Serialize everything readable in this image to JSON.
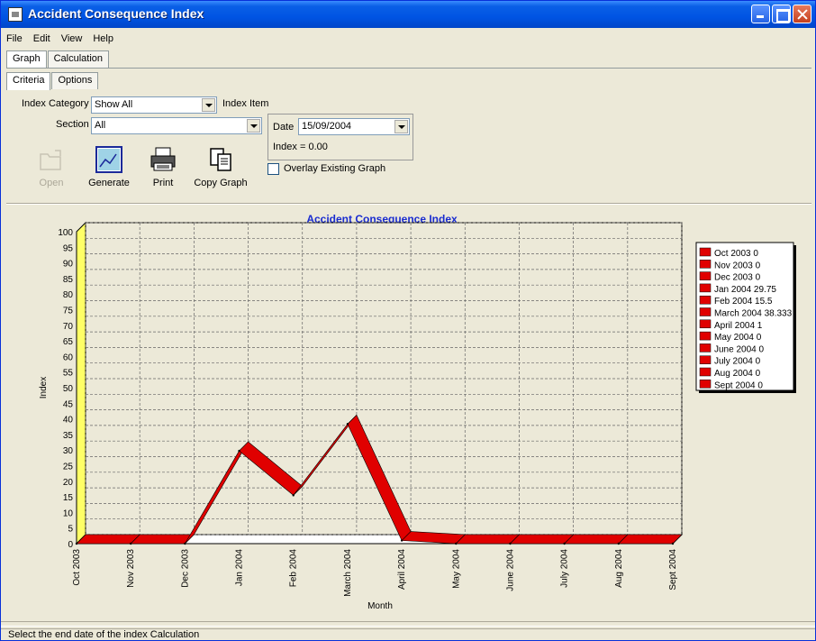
{
  "window": {
    "title": "Accident Consequence Index"
  },
  "menu": {
    "items": [
      "File",
      "Edit",
      "View",
      "Help"
    ]
  },
  "tabs_main": [
    {
      "label": "Graph",
      "active": true
    },
    {
      "label": "Calculation",
      "active": false
    }
  ],
  "tabs_sub": [
    {
      "label": "Criteria",
      "active": true
    },
    {
      "label": "Options",
      "active": false
    }
  ],
  "criteria": {
    "index_category_label": "Index Category",
    "index_category_value": "Show All",
    "index_item_label": "Index Item",
    "section_label": "Section",
    "section_value": "All",
    "date_label": "Date",
    "date_value": "15/09/2004",
    "index_value_text": "Index = 0.00",
    "overlay_label": "Overlay Existing Graph",
    "overlay_checked": false
  },
  "toolbar": {
    "open_label": "Open",
    "generate_label": "Generate",
    "print_label": "Print",
    "copy_label": "Copy Graph"
  },
  "status": {
    "text": "Select the end date of the index Calculation"
  },
  "chart_data": {
    "type": "line",
    "title": "Accident Consequence Index",
    "xlabel": "Month",
    "ylabel": "Index",
    "ylim": [
      0,
      100
    ],
    "y_ticks": [
      0,
      5,
      10,
      15,
      20,
      25,
      30,
      35,
      40,
      45,
      50,
      55,
      60,
      65,
      70,
      75,
      80,
      85,
      90,
      95,
      100
    ],
    "categories": [
      "Oct 2003",
      "Nov 2003",
      "Dec 2003",
      "Jan 2004",
      "Feb 2004",
      "March 2004",
      "April 2004",
      "May 2004",
      "June 2004",
      "July 2004",
      "Aug 2004",
      "Sept 2004"
    ],
    "values": [
      0,
      0,
      0,
      29.75,
      15.5,
      38.333,
      1,
      0,
      0,
      0,
      0,
      0
    ],
    "legend": [
      "Oct 2003 0",
      "Nov 2003 0",
      "Dec 2003 0",
      "Jan 2004 29.75",
      "Feb 2004 15.5",
      "March 2004 38.333",
      "April 2004 1",
      "May 2004 0",
      "June 2004 0",
      "July 2004 0",
      "Aug 2004 0",
      "Sept 2004 0"
    ],
    "legend_position": "right",
    "grid": true,
    "three_d": true,
    "series_color": "#e00000",
    "title_color": "#1a2cd0",
    "wall_color": "#ffff66"
  }
}
